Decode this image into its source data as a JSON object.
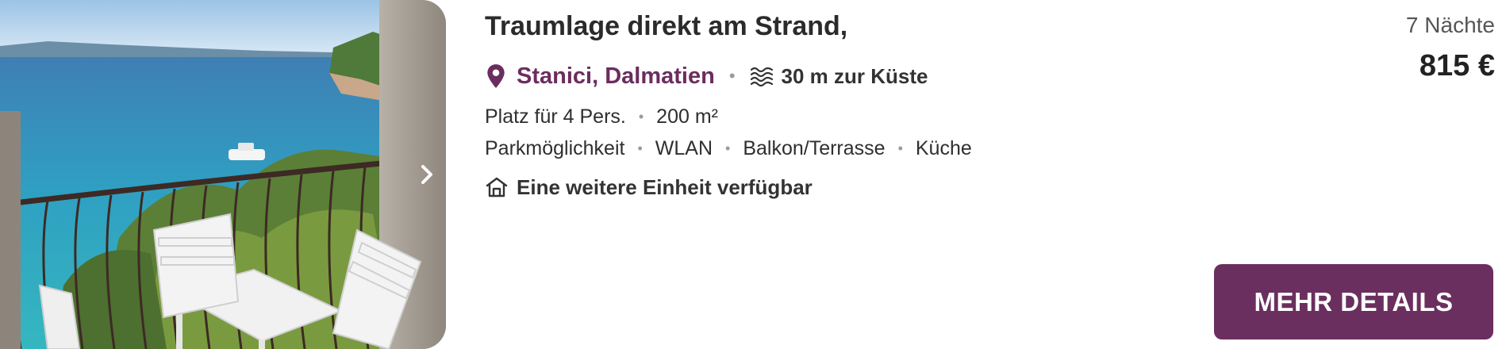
{
  "listing": {
    "title": "Traumlage direkt am Strand,",
    "location": "Stanici, Dalmatien",
    "coast_distance": "30 m zur Küste",
    "capacity": "Platz für 4 Pers.",
    "area": "200 m²",
    "amenities": [
      "Parkmöglichkeit",
      "WLAN",
      "Balkon/Terrasse",
      "Küche"
    ],
    "availability": "Eine weitere Einheit verfügbar"
  },
  "price": {
    "nights": "7 Nächte",
    "amount": "815 €"
  },
  "actions": {
    "details_label": "MEHR DETAILS"
  },
  "icons": {
    "location": "map-pin-icon",
    "coast": "waves-icon",
    "unit": "house-icon",
    "next": "chevron-right-icon"
  },
  "colors": {
    "brand": "#6a2f5f",
    "location_text": "#6b2d5f",
    "text": "#2b2b2b",
    "muted": "#9a9a9a"
  }
}
